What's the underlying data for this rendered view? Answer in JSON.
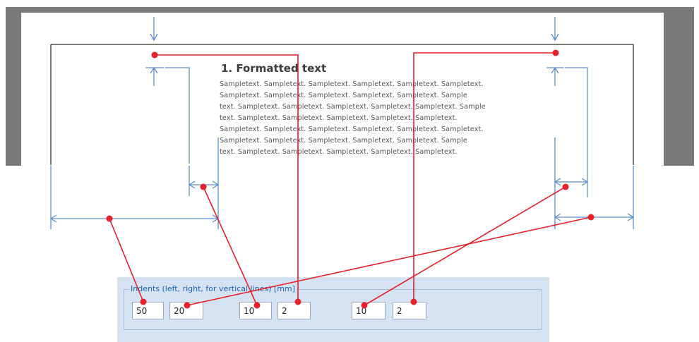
{
  "document": {
    "heading": "1. Formatted text",
    "lines": [
      "Sampletext. Sampletext. Sampletext. Sampletext. Sampletext. Sampletext.",
      "Sampletext. Sampletext. Sampletext. Sampletext. Sampletext. Sample",
      "text. Sampletext. Sampletext. Sampletext. Sampletext. Sampletext. Sample",
      "text. Sampletext. Sampletext. Sampletext. Sampletext. Sampletext.",
      "Sampletext. Sampletext. Sampletext. Sampletext. Sampletext. Sampletext.",
      "Sampletext. Sampletext. Sampletext. Sampletext. Sampletext. Sample",
      "text. Sampletext. Sampletext. Sampletext. Sampletext. Sampletext."
    ]
  },
  "indents": {
    "legend": "Indents (left, right, for vertical lines) [mm]",
    "left": "50",
    "right": "20",
    "vline1_left": "10",
    "vline1_right": "2",
    "vline2_left": "10",
    "vline2_right": "2"
  },
  "colors": {
    "dimension_lines": "#5b8fd0",
    "connectors": "#e8202a",
    "panel": "#d5e2f1",
    "legend_text": "#1c63b3",
    "page_frame": "#7a7a7a"
  }
}
